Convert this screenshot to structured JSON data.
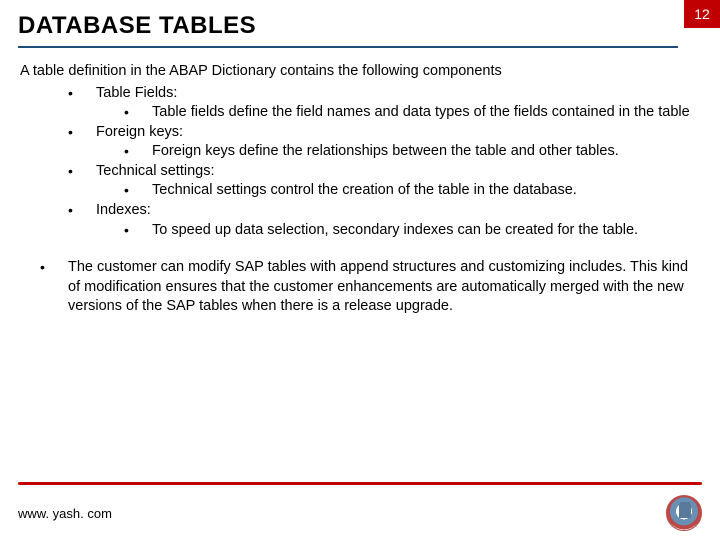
{
  "header": {
    "title": "DATABASE TABLES",
    "page_number": "12"
  },
  "content": {
    "intro": "A table definition in the ABAP Dictionary contains the following components",
    "components": [
      {
        "label": "Table Fields:",
        "detail": "Table fields define the field names and data types of the fields contained in the table"
      },
      {
        "label": "Foreign keys:",
        "detail": "Foreign keys define the relationships between the table and other tables."
      },
      {
        "label": "Technical settings:",
        "detail": "Technical settings control the creation of the table in the database."
      },
      {
        "label": "Indexes:",
        "detail": "To speed up data selection, secondary indexes can be created for the table."
      }
    ],
    "note": "The customer can modify SAP tables with append structures and customizing includes. This kind of modification ensures that the customer enhancements are automatically merged with the new versions of the SAP tables when there is a release upgrade."
  },
  "footer": {
    "url": "www. yash. com"
  }
}
